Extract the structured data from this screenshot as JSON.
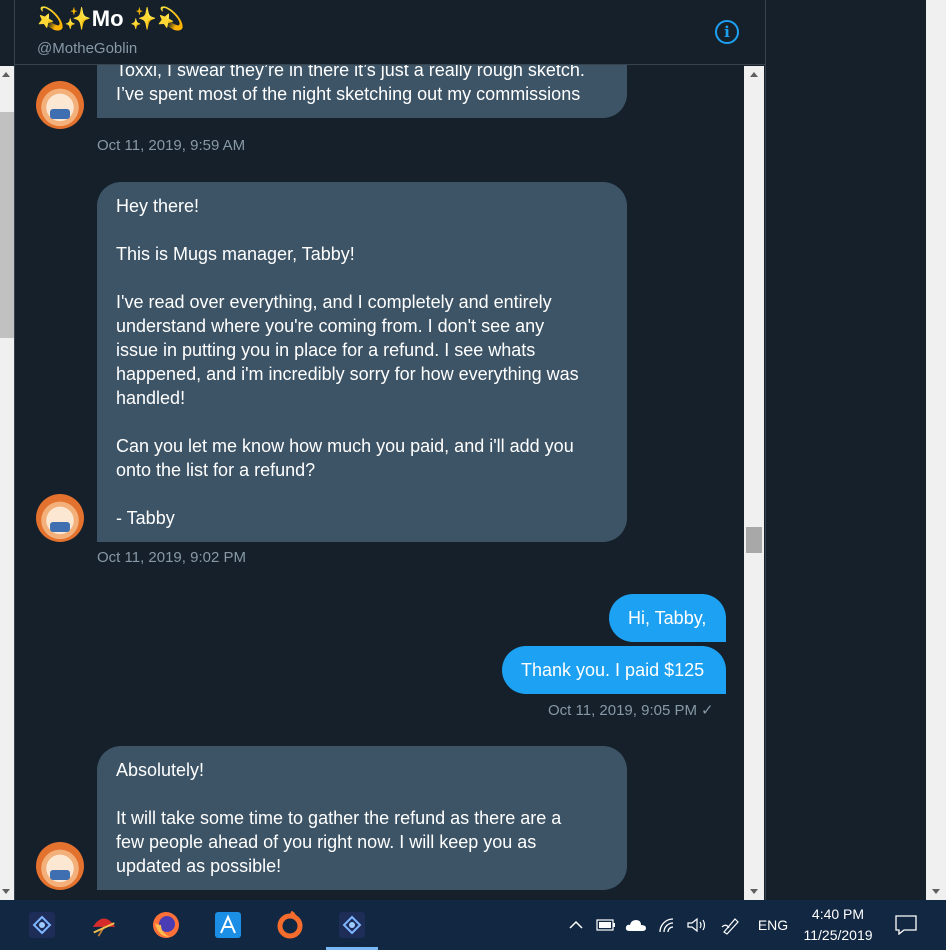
{
  "header": {
    "name": "💫✨Mo ✨💫",
    "handle": "@MotheGoblin"
  },
  "messages": [
    {
      "lines": [
        "Toxxi, I swear they’re in there it’s just a really rough sketch.",
        "I’ve spent most of the night sketching out my commissions"
      ],
      "timestamp": "Oct 11, 2019, 9:59 AM"
    },
    {
      "lines": [
        "Hey there!",
        "",
        "This is Mugs manager, Tabby!",
        "",
        "I've read over everything, and I completely and entirely",
        "understand where you're coming from. I don't see any",
        "issue in putting you in place for a refund. I see whats",
        "happened, and i'm incredibly sorry for how everything was",
        "handled!",
        "",
        "Can you let me know how much you paid, and i'll add you",
        "onto the list for a refund?",
        "",
        "- Tabby"
      ],
      "timestamp": "Oct 11, 2019, 9:02 PM"
    },
    {
      "sent_1": "Hi, Tabby,",
      "sent_2": "Thank you. I paid $125",
      "timestamp": "Oct 11, 2019, 9:05 PM",
      "read_mark": "✓"
    },
    {
      "lines": [
        "Absolutely!",
        "",
        "It will take some time to gather the refund as there are a",
        "few people ahead of you right now. I will keep you as",
        "updated as possible!"
      ]
    }
  ],
  "taskbar": {
    "apps": [
      "affinity-photo",
      "app-red-umbrella",
      "firefox",
      "affinity-designer",
      "origin",
      "affinity-photo-2"
    ],
    "tray": {
      "language": "ENG",
      "time": "4:40 PM",
      "date": "11/25/2019"
    }
  },
  "colors": {
    "background": "#15202b",
    "received_bubble": "#3d5466",
    "sent_bubble": "#1da1f2",
    "muted_text": "#8899a6",
    "taskbar": "#112742"
  }
}
